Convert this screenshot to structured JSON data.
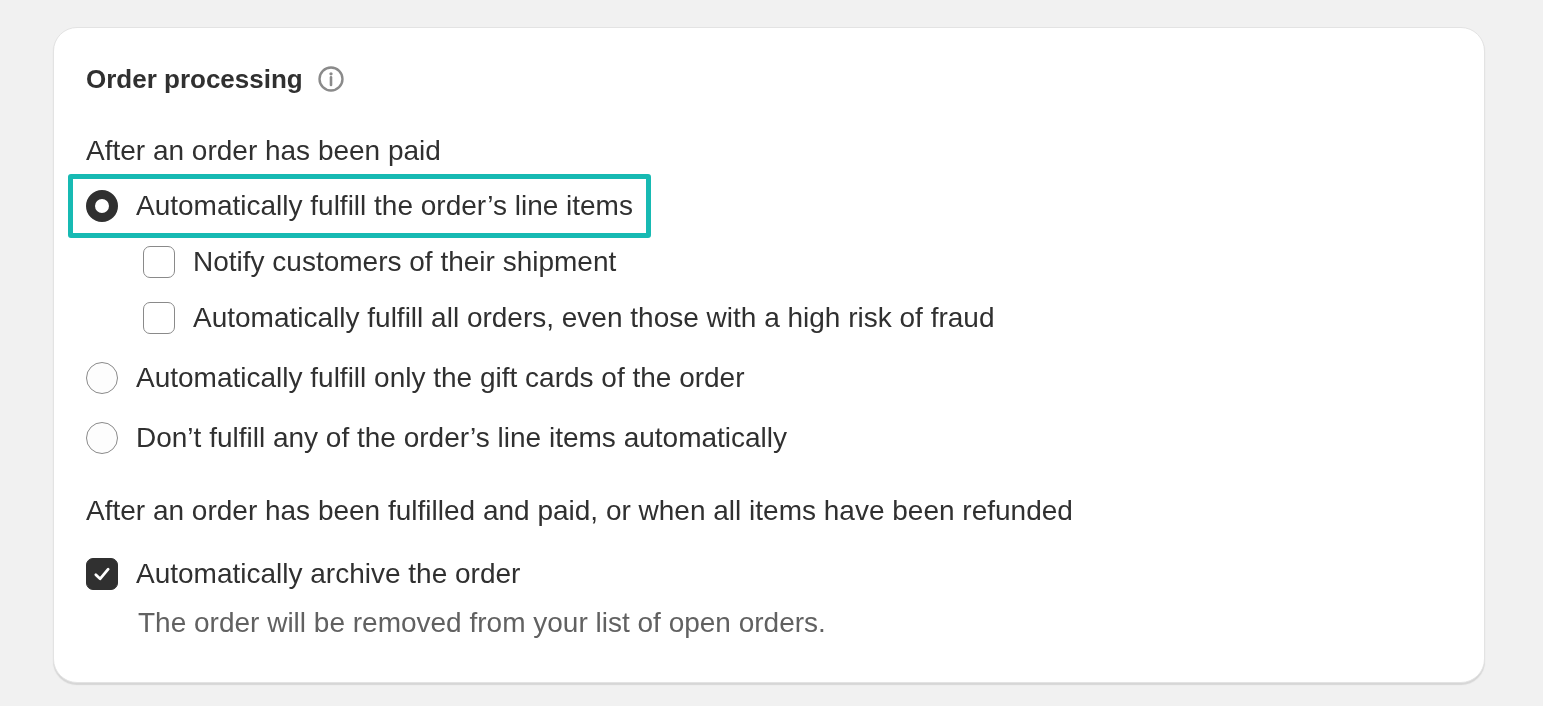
{
  "card": {
    "title": "Order processing"
  },
  "sections": [
    {
      "label": "After an order has been paid",
      "options": [
        {
          "kind": "radio",
          "label": "Automatically fulfill the order’s line items",
          "selected": true,
          "highlighted": true,
          "children": [
            {
              "kind": "checkbox",
              "label": "Notify customers of their shipment",
              "checked": false
            },
            {
              "kind": "checkbox",
              "label": "Automatically fulfill all orders, even those with a high risk of fraud",
              "checked": false
            }
          ]
        },
        {
          "kind": "radio",
          "label": "Automatically fulfill only the gift cards of the order",
          "selected": false,
          "highlighted": false
        },
        {
          "kind": "radio",
          "label": "Don’t fulfill any of the order’s line items automatically",
          "selected": false,
          "highlighted": false
        }
      ]
    },
    {
      "label": "After an order has been fulfilled and paid, or when all items have been refunded",
      "options": [
        {
          "kind": "checkbox",
          "label": "Automatically archive the order",
          "checked": true,
          "highlighted": false,
          "help": "The order will be removed from your list of open orders."
        }
      ]
    }
  ]
}
